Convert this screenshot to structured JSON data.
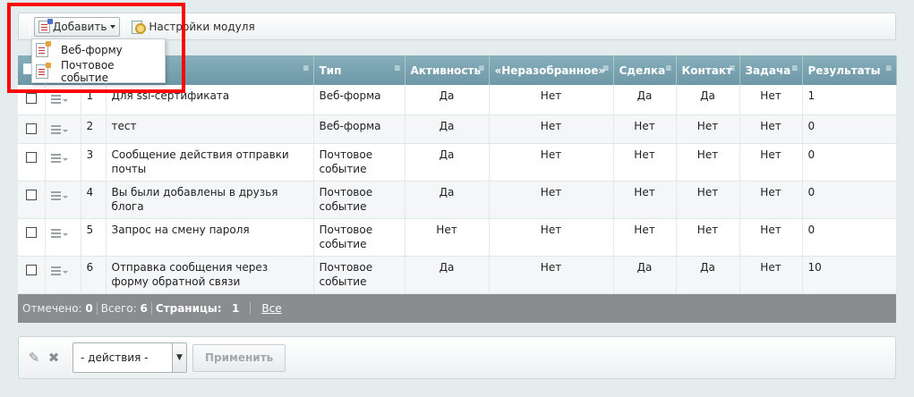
{
  "toolbar": {
    "add_label": "Добавить",
    "settings_label": "Настройки модуля"
  },
  "dropdown": {
    "items": [
      "Веб-форму",
      "Почтовое событие"
    ]
  },
  "table": {
    "headers": {
      "name_partial": "е",
      "type": "Тип",
      "active": "Активность",
      "unsorted": "«Неразобранное»",
      "deal": "Сделка",
      "contact": "Контакт",
      "task": "Задача",
      "results": "Результаты"
    },
    "sort_glyph": "≡",
    "rows": [
      {
        "id": "1",
        "name": "Для ssl-сертификата",
        "type": "Веб-форма",
        "active": "Да",
        "unsorted": "Нет",
        "deal": "Да",
        "contact": "Да",
        "task": "Нет",
        "results": "1"
      },
      {
        "id": "2",
        "name": "тест",
        "type": "Веб-форма",
        "active": "Да",
        "unsorted": "Нет",
        "deal": "Нет",
        "contact": "Нет",
        "task": "Нет",
        "results": "0"
      },
      {
        "id": "3",
        "name": "Сообщение действия отправки почты",
        "type": "Почтовое событие",
        "active": "Да",
        "unsorted": "Нет",
        "deal": "Нет",
        "contact": "Нет",
        "task": "Нет",
        "results": "0"
      },
      {
        "id": "4",
        "name": "Вы были добавлены в друзья блога",
        "type": "Почтовое событие",
        "active": "Да",
        "unsorted": "Нет",
        "deal": "Нет",
        "contact": "Нет",
        "task": "Нет",
        "results": "0"
      },
      {
        "id": "5",
        "name": "Запрос на смену пароля",
        "type": "Почтовое событие",
        "active": "Нет",
        "unsorted": "Нет",
        "deal": "Нет",
        "contact": "Нет",
        "task": "Нет",
        "results": "0"
      },
      {
        "id": "6",
        "name": "Отправка сообщения через форму обратной связи",
        "type": "Почтовое событие",
        "active": "Да",
        "unsorted": "Нет",
        "deal": "Да",
        "contact": "Да",
        "task": "Нет",
        "results": "10"
      }
    ]
  },
  "footer": {
    "checked_label": "Отмечено:",
    "checked_value": "0",
    "total_label": "Всего:",
    "total_value": "6",
    "pages_label": "Страницы:",
    "pages_value": "1",
    "all_label": "Все"
  },
  "actions": {
    "select_value": "- действия -",
    "apply_label": "Применить"
  },
  "colors": {
    "header_bg": "#7aa3b1",
    "footer_bg": "#8a8d8e",
    "highlight": "#ff0000"
  }
}
